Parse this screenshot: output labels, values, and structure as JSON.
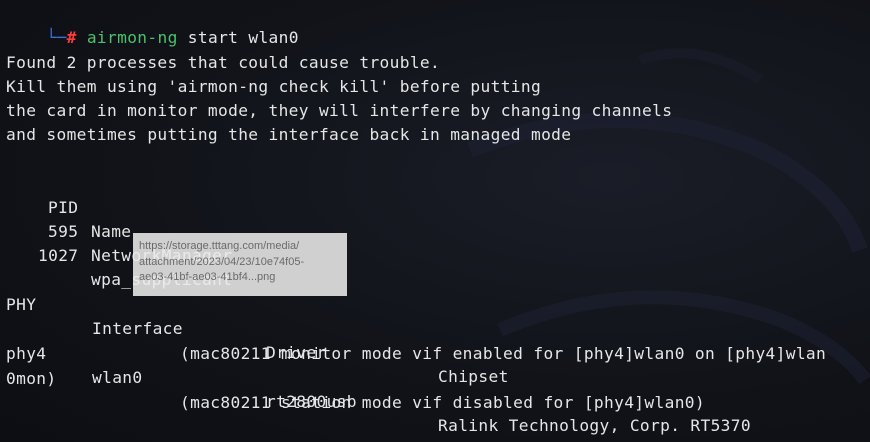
{
  "prompt": {
    "corner": "└─",
    "hash": "#",
    "command": "airmon-ng",
    "args": " start wlan0"
  },
  "output": {
    "warning_lines": [
      "Found 2 processes that could cause trouble.",
      "Kill them using 'airmon-ng check kill' before putting",
      "the card in monitor mode, they will interfere by changing channels",
      "and sometimes putting the interface back in managed mode"
    ],
    "process_table": {
      "headers": {
        "pid": "PID",
        "name": "Name"
      },
      "rows": [
        {
          "pid": "595",
          "name": "NetworkManager"
        },
        {
          "pid": "1027",
          "name": "wpa_supplicant"
        }
      ]
    },
    "interface_table": {
      "headers": {
        "phy": "PHY",
        "interface": "Interface",
        "driver": "Driver",
        "chipset": "Chipset"
      },
      "rows": [
        {
          "phy": "phy4",
          "interface": "wlan0",
          "driver": "rt2800usb",
          "chipset": "Ralink Technology, Corp. RT5370"
        }
      ]
    },
    "monitor_msg_1": "(mac80211 monitor mode vif enabled for [phy4]wlan0 on [phy4]wlan",
    "monitor_msg_wrap": "0mon)",
    "station_msg": "(mac80211 station mode vif disabled for [phy4]wlan0)"
  },
  "tooltip": {
    "lines": [
      "https://storage.tttang.com/media/",
      "attachment/2023/04/23/10e74f05-",
      "ae03-41bf-ae03-41bf4...png"
    ]
  },
  "colors": {
    "background": "#111319",
    "text": "#e6e6e6",
    "prompt_hash": "#ff3b3b",
    "command": "#4ac26b",
    "prompt_corner": "#3b6fd8"
  }
}
